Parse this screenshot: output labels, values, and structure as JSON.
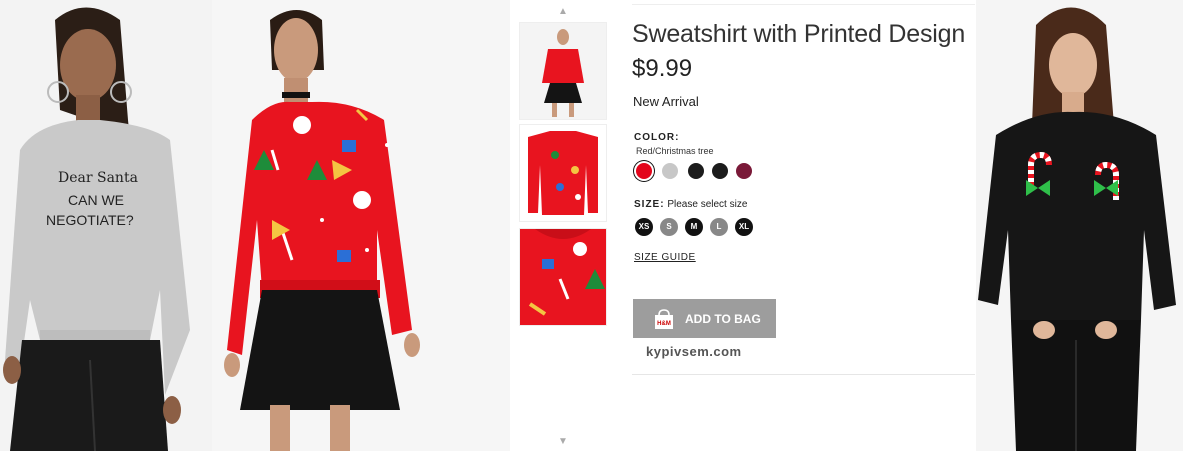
{
  "product": {
    "title": "Sweatshirt with Printed Design",
    "price": "$9.99",
    "badge": "New Arrival"
  },
  "color": {
    "label": "COLOR:",
    "selected": "Red/Christmas tree",
    "swatches": [
      "#e3051b",
      "#c7c7c7",
      "#1c1c1c",
      "#1c1c1c",
      "#7a1938"
    ]
  },
  "size": {
    "label": "SIZE:",
    "hint": "Please select size",
    "options": [
      "XS",
      "S",
      "M",
      "L",
      "XL"
    ]
  },
  "size_guide": "SIZE GUIDE",
  "cart": {
    "add_label": "ADD TO BAG",
    "bag_logo": "H&M"
  },
  "watermark": "kypivsem.com",
  "photos": {
    "left_print_line1": "Dear Santa",
    "left_print_line2": "CAN WE",
    "left_print_line3": "NEGOTIATE?"
  },
  "icons": {
    "scroll_up": "chevron-up-icon",
    "scroll_down": "chevron-down-icon",
    "bag": "shopping-bag-icon"
  },
  "colors": {
    "sweatshirt_red": "#e8141f",
    "button_gray": "#9d9d9d",
    "text_dark": "#333333"
  }
}
